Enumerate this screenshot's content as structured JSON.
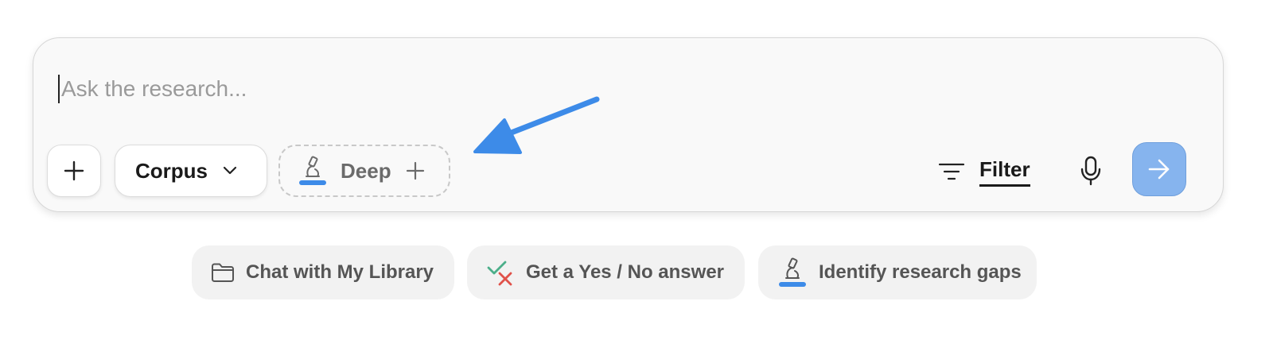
{
  "search": {
    "placeholder": "Ask the research...",
    "value": ""
  },
  "toolbar": {
    "add_icon": "plus-icon",
    "corpus_label": "Corpus",
    "corpus_icon": "chevron-down-icon",
    "deep_icon": "microscope-icon",
    "deep_label": "Deep",
    "deep_add_icon": "plus-icon",
    "filter_icon": "filter-lines-icon",
    "filter_label": "Filter",
    "mic_icon": "microphone-icon",
    "send_icon": "arrow-right-icon"
  },
  "annotation": {
    "icon": "arrow-pointer-icon",
    "color": "#3d8be8"
  },
  "suggestions": [
    {
      "icon": "folder-icon",
      "label": "Chat with My Library"
    },
    {
      "icon": "check-x-icon",
      "label": "Get a Yes / No answer"
    },
    {
      "icon": "microscope-icon",
      "label": "Identify research gaps"
    }
  ],
  "colors": {
    "accent": "#3d8be8",
    "send_button": "#86b4ee",
    "check_green": "#4caf8a",
    "x_red": "#e0524a"
  }
}
